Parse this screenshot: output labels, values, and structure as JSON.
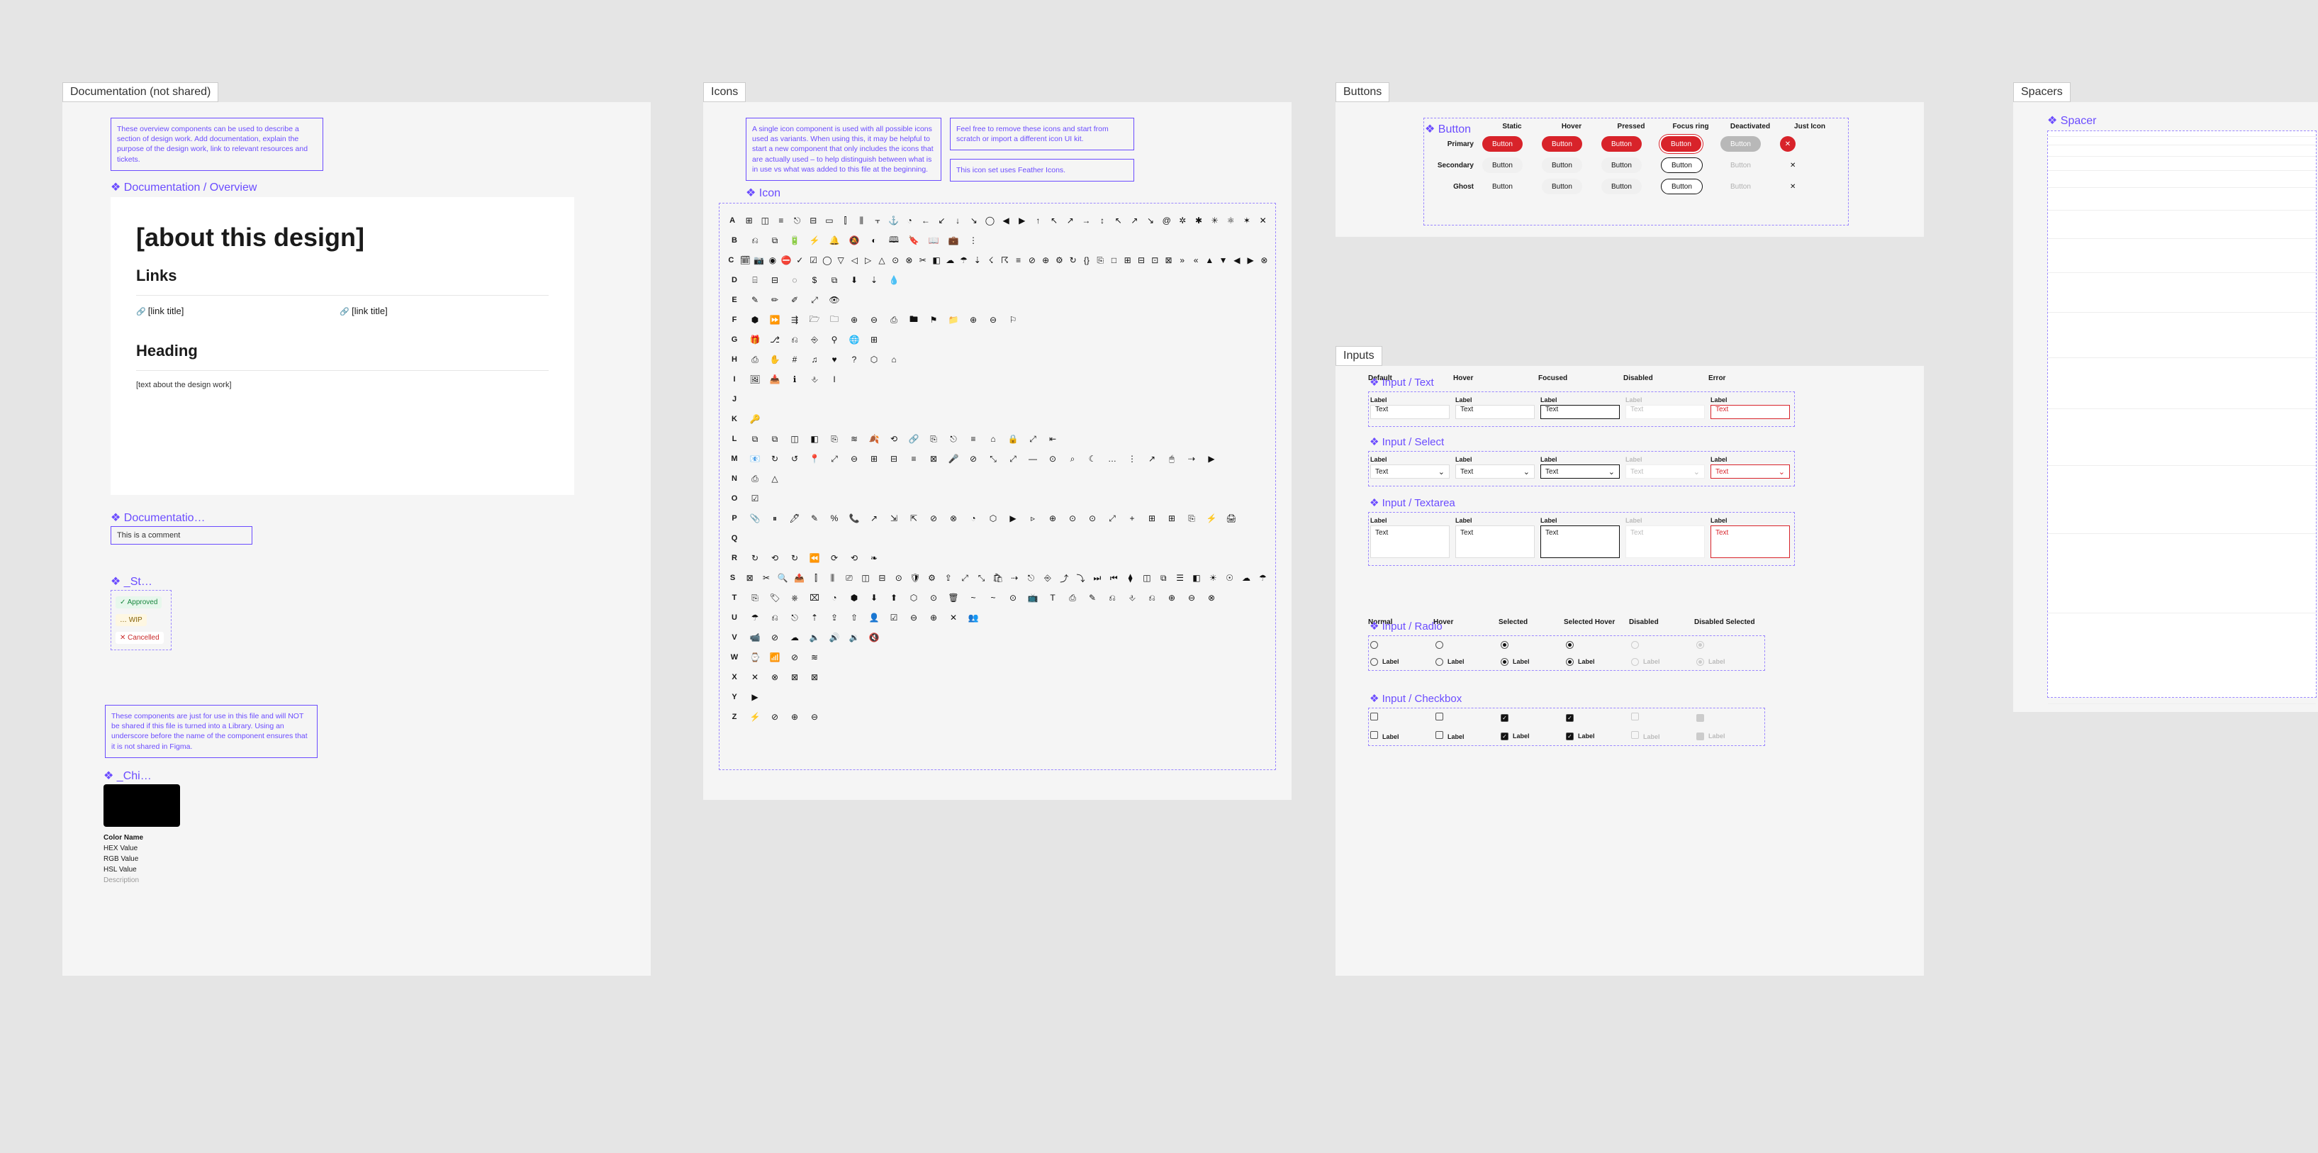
{
  "frames": {
    "documentation": "Documentation (not shared)",
    "icons": "Icons",
    "buttons": "Buttons",
    "inputs": "Inputs",
    "spacers": "Spacers"
  },
  "doc": {
    "note1": "These overview components can be used to describe a section of design work. Add documentation, explain the purpose of the design work, link to relevant resources and tickets.",
    "overview_label": "Documentation / Overview",
    "card_title": "[about this design]",
    "links_heading": "Links",
    "link_text": "[link title]",
    "body_heading": "Heading",
    "body_text": "[text about the design work]",
    "comment_label": "Documentatio…",
    "comment_text": "This is a comment",
    "status_label": "_St…",
    "status": {
      "approved": "✓ Approved",
      "wip": "… WIP",
      "cancelled": "✕ Cancelled"
    },
    "note2": "These components are just for use in this file and will NOT be shared if this file is turned into a Library. Using an underscore before the name of the component ensures that it is not shared in Figma.",
    "chip_label": "_Chi…",
    "color_meta": [
      "Color Name",
      "HEX Value",
      "RGB Value",
      "HSL Value",
      "Description"
    ]
  },
  "icons": {
    "note1": "A single icon component is used with all possible icons used as variants. When using this, it may be helpful to start a new component that only includes the icons that are actually used – to help distinguish between what is in use vs what was added to this file at the beginning.",
    "note2": "Feel free to remove these icons and start from scratch or import a different icon UI kit.",
    "note3": "This icon set uses Feather Icons.",
    "label": "Icon",
    "rows": [
      {
        "l": "A",
        "g": [
          "⊞",
          "◫",
          "≡",
          "⎋",
          "⊟",
          "▭",
          "⫿",
          "⫼",
          "⫟",
          "⚓",
          "◔",
          "←",
          "↙",
          "↓",
          "↘",
          "◯",
          "◀",
          "▶",
          "↑",
          "↖",
          "↗",
          "→",
          "↕",
          "↖",
          "↗",
          "↘",
          "@",
          "✲",
          "✱",
          "✳",
          "⚛",
          "✶",
          "✕"
        ]
      },
      {
        "l": "B",
        "g": [
          "⎌",
          "⧉",
          "🔋",
          "⚡",
          "🔔",
          "🔕",
          "◐",
          "🕮",
          "🔖",
          "📖",
          "💼",
          "⋮"
        ]
      },
      {
        "l": "C",
        "g": [
          "🗓",
          "📷",
          "◉",
          "⛔",
          "✓",
          "☑",
          "◯",
          "▽",
          "◁",
          "▷",
          "△",
          "⊙",
          "⊗",
          "✂",
          "◧",
          "☁",
          "☂",
          "⇣",
          "☇",
          "☈",
          "≡",
          "⊘",
          "⊕",
          "⚙",
          "↻",
          "{}",
          "⎘",
          "□",
          "⊞",
          "⊟",
          "⊡",
          "⊠",
          "»",
          "«",
          "▲",
          "▼",
          "◀",
          "▶",
          "⊗"
        ]
      },
      {
        "l": "D",
        "g": [
          "⌸",
          "⊟",
          "◌",
          "$",
          "⧉",
          "⬇",
          "⇣",
          "💧"
        ]
      },
      {
        "l": "E",
        "g": [
          "✎",
          "✏",
          "✐",
          "⤢",
          "👁"
        ]
      },
      {
        "l": "F",
        "g": [
          "⬢",
          "⏩",
          "⇶",
          "🗁",
          "🗀",
          "⊕",
          "⊖",
          "⎙",
          "🖿",
          "⚑",
          "📁",
          "⊕",
          "⊖",
          "⚐"
        ]
      },
      {
        "l": "G",
        "g": [
          "🎁",
          "⎇",
          "⎌",
          "⎆",
          "⚲",
          "🌐",
          "⊞"
        ]
      },
      {
        "l": "H",
        "g": [
          "⎙",
          "✋",
          "#",
          "♫",
          "♥",
          "?",
          "⬡",
          "⌂"
        ]
      },
      {
        "l": "I",
        "g": [
          "🖼",
          "📥",
          "ℹ",
          "⎀",
          "I"
        ]
      },
      {
        "l": "J",
        "g": []
      },
      {
        "l": "K",
        "g": [
          "🔑"
        ]
      },
      {
        "l": "L",
        "g": [
          "⧉",
          "⧉",
          "◫",
          "◧",
          "⎘",
          "≋",
          "🍂",
          "⟲",
          "🔗",
          "⎘",
          "⎋",
          "≡",
          "⌂",
          "🔒",
          "⤢",
          "⇤"
        ]
      },
      {
        "l": "M",
        "g": [
          "📧",
          "↻",
          "↺",
          "📍",
          "⤢",
          "⊖",
          "⊞",
          "⊟",
          "≡",
          "⊠",
          "🎤",
          "⊘",
          "⤡",
          "⤢",
          "—",
          "⊙",
          "⌕",
          "☾",
          "…",
          "⋮",
          "↗",
          "🖱",
          "⇢",
          "▶"
        ]
      },
      {
        "l": "N",
        "g": [
          "⎙",
          "△"
        ]
      },
      {
        "l": "O",
        "g": [
          "☑"
        ]
      },
      {
        "l": "P",
        "g": [
          "📎",
          "⏸",
          "🖊",
          "✎",
          "%",
          "📞",
          "↗",
          "⇲",
          "⇱",
          "⊘",
          "⊗",
          "◔",
          "⬡",
          "▶",
          "▹",
          "⊕",
          "⊙",
          "⊙",
          "⤢",
          "+",
          "⊞",
          "⊞",
          "⎘",
          "⚡",
          "🖨"
        ]
      },
      {
        "l": "Q",
        "g": []
      },
      {
        "l": "R",
        "g": [
          "↻",
          "⟲",
          "↻",
          "⏪",
          "⟳",
          "⟲",
          "❧"
        ]
      },
      {
        "l": "S",
        "g": [
          "⊠",
          "✂",
          "🔍",
          "📤",
          "⫿",
          "⫼",
          "⎚",
          "◫",
          "⊟",
          "⊙",
          "🛡",
          "⚙",
          "⇪",
          "⤢",
          "⤡",
          "🛍",
          "⇢",
          "⎋",
          "⎆",
          "⤴",
          "⤵",
          "⏭",
          "⏮",
          "⧫",
          "◫",
          "⧉",
          "☰",
          "◧",
          "☀",
          "☉",
          "☁",
          "☂"
        ]
      },
      {
        "l": "T",
        "g": [
          "⎘",
          "🏷",
          "⎈",
          "⌧",
          "◔",
          "⬢",
          "⬇",
          "⬆",
          "⬡",
          "⊙",
          "🗑",
          "~",
          "~",
          "⊙",
          "📺",
          "T",
          "⎙",
          "✎",
          "⎌",
          "⎀",
          "⎌",
          "⊕",
          "⊖",
          "⊗"
        ]
      },
      {
        "l": "U",
        "g": [
          "☂",
          "⎌",
          "⎋",
          "⇡",
          "⇪",
          "⇧",
          "👤",
          "☑",
          "⊖",
          "⊕",
          "✕",
          "👥"
        ]
      },
      {
        "l": "V",
        "g": [
          "📹",
          "⊘",
          "☁",
          "🔈",
          "🔊",
          "🔉",
          "🔇"
        ]
      },
      {
        "l": "W",
        "g": [
          "⌚",
          "📶",
          "⊘",
          "≋"
        ]
      },
      {
        "l": "X",
        "g": [
          "✕",
          "⊗",
          "⊠",
          "⊠"
        ]
      },
      {
        "l": "Y",
        "g": [
          "▶"
        ]
      },
      {
        "l": "Z",
        "g": [
          "⚡",
          "⊘",
          "⊕",
          "⊖"
        ]
      }
    ]
  },
  "buttons": {
    "label": "Button",
    "columns": [
      "Static",
      "Hover",
      "Pressed",
      "Focus ring",
      "Deactivated",
      "Just Icon"
    ],
    "rows": [
      "Primary",
      "Secondary",
      "Ghost"
    ],
    "text": "Button",
    "x": "✕"
  },
  "inputs": {
    "columns": [
      "Default",
      "Hover",
      "Focused",
      "Disabled",
      "Error"
    ],
    "text_label": "Input / Text",
    "select_label": "Input / Select",
    "textarea_label": "Input / Textarea",
    "field_label": "Label",
    "field_value": "Text",
    "radio_label": "Input / Radio",
    "checkbox_label": "Input / Checkbox",
    "radio_columns": [
      "Normal",
      "Hover",
      "Selected",
      "Selected Hover",
      "Disabled",
      "Disabled Selected"
    ],
    "option_label": "Label"
  },
  "spacers": {
    "label": "Spacer",
    "heights": [
      8,
      12,
      16,
      20,
      24,
      32,
      40,
      48,
      56,
      64,
      72,
      80,
      96,
      112,
      128
    ]
  }
}
